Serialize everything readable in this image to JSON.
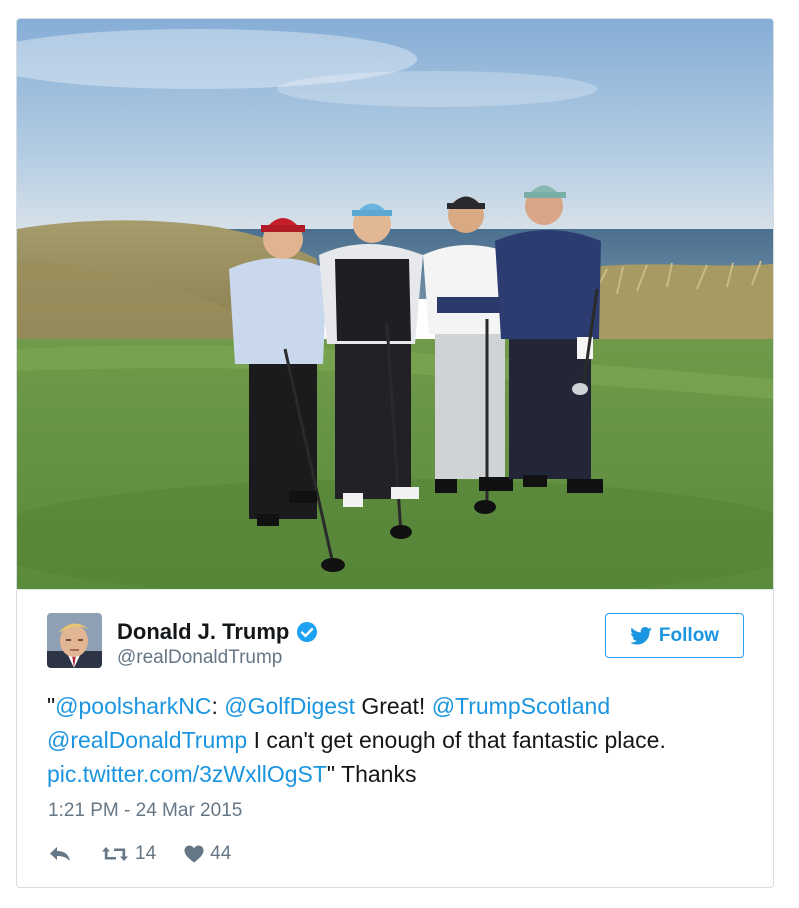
{
  "tweet": {
    "author": {
      "display_name": "Donald J. Trump",
      "handle": "@realDonaldTrump",
      "verified": true,
      "avatar_icon": "profile-photo"
    },
    "follow": {
      "label": "Follow",
      "icon": "twitter-bird-icon"
    },
    "text_parts": [
      {
        "text": "\"",
        "link": false
      },
      {
        "text": "@poolsharkNC",
        "link": true
      },
      {
        "text": ": ",
        "link": false
      },
      {
        "text": "@GolfDigest",
        "link": true
      },
      {
        "text": " Great! ",
        "link": false
      },
      {
        "text": "@TrumpScotland",
        "link": true
      },
      {
        "text": " ",
        "link": false
      },
      {
        "text": "@realDonaldTrump",
        "link": true
      },
      {
        "text": " I can't get enough of that fantastic place. ",
        "link": false
      },
      {
        "text": "pic.twitter.com/3zWxllOgST",
        "link": true
      },
      {
        "text": "\" Thanks",
        "link": false
      }
    ],
    "timestamp": "1:21 PM - 24 Mar 2015",
    "actions": {
      "reply_icon": "reply-icon",
      "retweet_icon": "retweet-icon",
      "retweet_count": "14",
      "like_icon": "heart-icon",
      "like_count": "44"
    },
    "media": {
      "type": "photo",
      "subject": "four golfers on a tee box by the sea"
    }
  },
  "colors": {
    "link": "#1b95e0",
    "text": "#14171a",
    "muted": "#657786",
    "verified": "#1da1f2"
  }
}
